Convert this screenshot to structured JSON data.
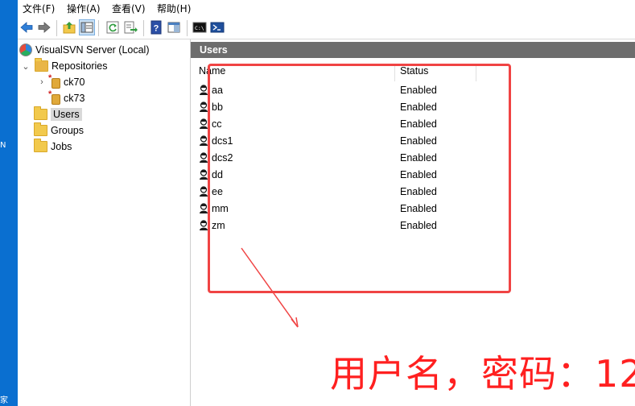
{
  "desktop": {
    "fragments": [
      "N",
      "家"
    ]
  },
  "menu": [
    "文件(F)",
    "操作(A)",
    "查看(V)",
    "帮助(H)"
  ],
  "tree": {
    "root": "VisualSVN Server (Local)",
    "repositories": "Repositories",
    "repos": [
      "ck70",
      "ck73"
    ],
    "users": "Users",
    "groups": "Groups",
    "jobs": "Jobs"
  },
  "pane": {
    "title": "Users",
    "columns": {
      "name": "Name",
      "status": "Status"
    },
    "users": [
      {
        "name": "aa",
        "status": "Enabled"
      },
      {
        "name": "bb",
        "status": "Enabled"
      },
      {
        "name": "cc",
        "status": "Enabled"
      },
      {
        "name": "dcs1",
        "status": "Enabled"
      },
      {
        "name": "dcs2",
        "status": "Enabled"
      },
      {
        "name": "dd",
        "status": "Enabled"
      },
      {
        "name": "ee",
        "status": "Enabled"
      },
      {
        "name": "mm",
        "status": "Enabled"
      },
      {
        "name": "zm",
        "status": "Enabled"
      }
    ]
  },
  "annotation": {
    "caption": "用户名，密码：12",
    "color": "#f04444"
  },
  "colors": {
    "header_bar": "#6d6d6d",
    "selection": "#d9d9d9",
    "desktop": "#0a6fd0"
  }
}
